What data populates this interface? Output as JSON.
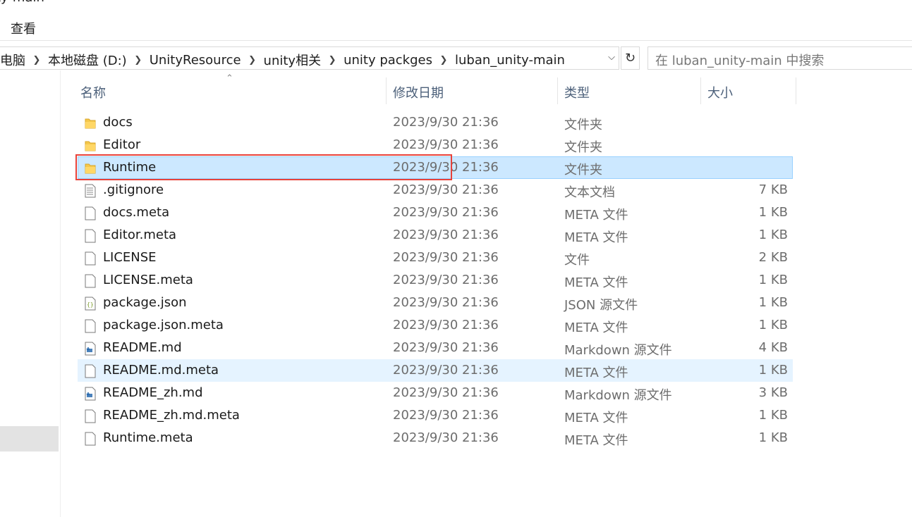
{
  "window": {
    "title_partial": "ty-main"
  },
  "ribbon": {
    "tab_view": "查看"
  },
  "address": {
    "crumbs": [
      "电脑",
      "本地磁盘 (D:)",
      "UnityResource",
      "unity相关",
      "unity packges",
      "luban_unity-main"
    ],
    "separator_icon": "chevron-right-icon",
    "dropdown_icon": "chevron-down-icon",
    "refresh_icon": "refresh-icon",
    "refresh_glyph": "↻",
    "chevron_glyph": "❯",
    "dropdown_glyph": "⌵"
  },
  "search": {
    "placeholder": "在 luban_unity-main 中搜索"
  },
  "columns": {
    "name": "名称",
    "date": "修改日期",
    "type": "类型",
    "size": "大小",
    "sort_glyph": "⌃"
  },
  "files": [
    {
      "name": "docs",
      "date": "2023/9/30 21:36",
      "type": "文件夹",
      "size": "",
      "icon": "folder-icon"
    },
    {
      "name": "Editor",
      "date": "2023/9/30 21:36",
      "type": "文件夹",
      "size": "",
      "icon": "folder-icon"
    },
    {
      "name": "Runtime",
      "date": "2023/9/30 21:36",
      "type": "文件夹",
      "size": "",
      "icon": "folder-icon",
      "state": "selected"
    },
    {
      "name": ".gitignore",
      "date": "2023/9/30 21:36",
      "type": "文本文档",
      "size": "7 KB",
      "icon": "text-file-icon"
    },
    {
      "name": "docs.meta",
      "date": "2023/9/30 21:36",
      "type": "META 文件",
      "size": "1 KB",
      "icon": "file-icon"
    },
    {
      "name": "Editor.meta",
      "date": "2023/9/30 21:36",
      "type": "META 文件",
      "size": "1 KB",
      "icon": "file-icon"
    },
    {
      "name": "LICENSE",
      "date": "2023/9/30 21:36",
      "type": "文件",
      "size": "2 KB",
      "icon": "file-icon"
    },
    {
      "name": "LICENSE.meta",
      "date": "2023/9/30 21:36",
      "type": "META 文件",
      "size": "1 KB",
      "icon": "file-icon"
    },
    {
      "name": "package.json",
      "date": "2023/9/30 21:36",
      "type": "JSON 源文件",
      "size": "1 KB",
      "icon": "json-file-icon"
    },
    {
      "name": "package.json.meta",
      "date": "2023/9/30 21:36",
      "type": "META 文件",
      "size": "1 KB",
      "icon": "file-icon"
    },
    {
      "name": "README.md",
      "date": "2023/9/30 21:36",
      "type": "Markdown 源文件",
      "size": "4 KB",
      "icon": "markdown-file-icon"
    },
    {
      "name": "README.md.meta",
      "date": "2023/9/30 21:36",
      "type": "META 文件",
      "size": "1 KB",
      "icon": "file-icon",
      "state": "hovered"
    },
    {
      "name": "README_zh.md",
      "date": "2023/9/30 21:36",
      "type": "Markdown 源文件",
      "size": "3 KB",
      "icon": "markdown-file-icon"
    },
    {
      "name": "README_zh.md.meta",
      "date": "2023/9/30 21:36",
      "type": "META 文件",
      "size": "1 KB",
      "icon": "file-icon"
    },
    {
      "name": "Runtime.meta",
      "date": "2023/9/30 21:36",
      "type": "META 文件",
      "size": "1 KB",
      "icon": "file-icon"
    }
  ],
  "colors": {
    "selection_bg": "#cce8ff",
    "hover_bg": "#e5f3ff",
    "highlight_box": "#e8423a",
    "folder": "#f5c84c"
  }
}
